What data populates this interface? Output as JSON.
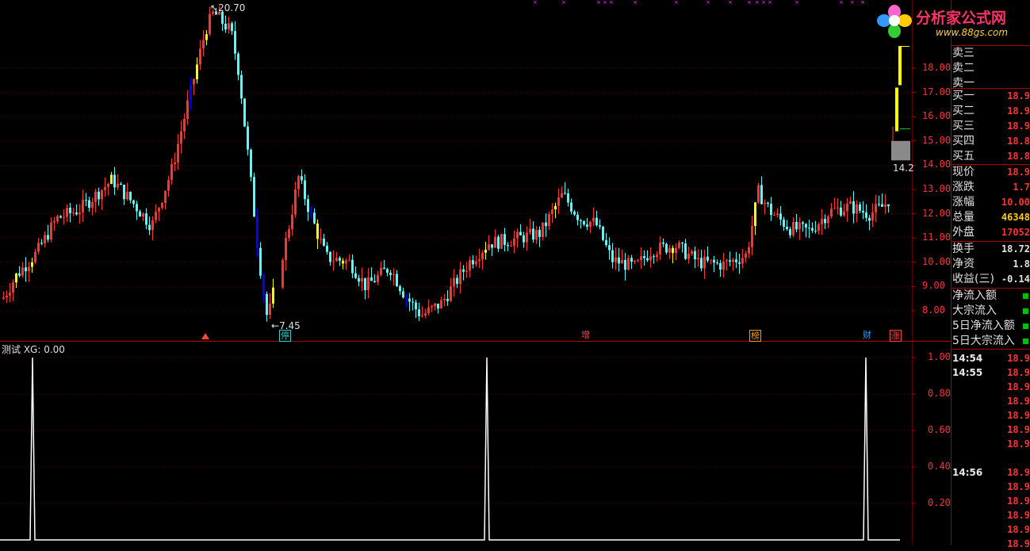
{
  "logo": {
    "text": "分析家公式网",
    "url": "www.88gs.com"
  },
  "main_chart": {
    "type": "candlestick",
    "y_ticks": [
      "18.00",
      "17.00",
      "16.00",
      "15.00",
      "14.00",
      "13.00",
      "12.00",
      "11.00",
      "10.00",
      "9.00",
      "8.00"
    ],
    "y_tick_values": [
      18,
      17,
      16,
      15,
      14,
      13,
      12,
      11,
      10,
      9,
      8
    ],
    "high_label": "20.70",
    "low_label": "7.45",
    "right_price_label": "14.2",
    "markers": [
      {
        "text": "停",
        "color": "#33cccc"
      },
      {
        "text": "增",
        "color": "#ff4444"
      },
      {
        "text": "榜",
        "color": "#ff9900"
      },
      {
        "text": "财",
        "color": "#3399ff"
      },
      {
        "text": "涨",
        "color": "#ff4444"
      }
    ]
  },
  "indicator": {
    "title": "测试 XG: 0.00",
    "y_ticks": [
      "1.00",
      "0.80",
      "0.60",
      "0.40",
      "0.20"
    ],
    "y_tick_values": [
      1.0,
      0.8,
      0.6,
      0.4,
      0.2
    ]
  },
  "order_book": {
    "sell": [
      "卖三",
      "卖二",
      "卖一"
    ],
    "buy": [
      {
        "label": "买一",
        "value": "18.9"
      },
      {
        "label": "买二",
        "value": "18.9"
      },
      {
        "label": "买三",
        "value": "18.9"
      },
      {
        "label": "买四",
        "value": "18.8"
      },
      {
        "label": "买五",
        "value": "18.8"
      }
    ]
  },
  "quote": [
    {
      "label": "现价",
      "value": "18.9",
      "color": "#ff3333"
    },
    {
      "label": "涨跌",
      "value": "1.7",
      "color": "#ff3333"
    },
    {
      "label": "涨幅",
      "value": "10.00",
      "color": "#ff3333"
    },
    {
      "label": "总量",
      "value": "46348",
      "color": "#ffcc00"
    },
    {
      "label": "外盘",
      "value": "17052",
      "color": "#ff3333"
    }
  ],
  "stats": [
    {
      "label": "换手",
      "value": "18.72",
      "color": "#e0e0e0"
    },
    {
      "label": "净资",
      "value": "1.8",
      "color": "#e0e0e0"
    },
    {
      "label": "收益(三)",
      "value": "-0.14",
      "color": "#e0e0e0"
    }
  ],
  "flows": [
    "净流入额",
    "大宗流入",
    "5日净流入额",
    "5日大宗流入"
  ],
  "ticks": [
    {
      "time": "14:54",
      "price": "18.9"
    },
    {
      "time": "14:55",
      "price": "18.9"
    },
    {
      "time": "",
      "price": "18.9"
    },
    {
      "time": "",
      "price": "18.9"
    },
    {
      "time": "",
      "price": "18.9"
    },
    {
      "time": "",
      "price": "18.9"
    },
    {
      "time": "",
      "price": "18.9"
    },
    {
      "time": "14:56",
      "price": "18.9"
    },
    {
      "time": "",
      "price": "18.9"
    },
    {
      "time": "",
      "price": "18.9"
    },
    {
      "time": "",
      "price": "18.9"
    },
    {
      "time": "",
      "price": "18.9"
    },
    {
      "time": "",
      "price": "18.9"
    }
  ]
}
